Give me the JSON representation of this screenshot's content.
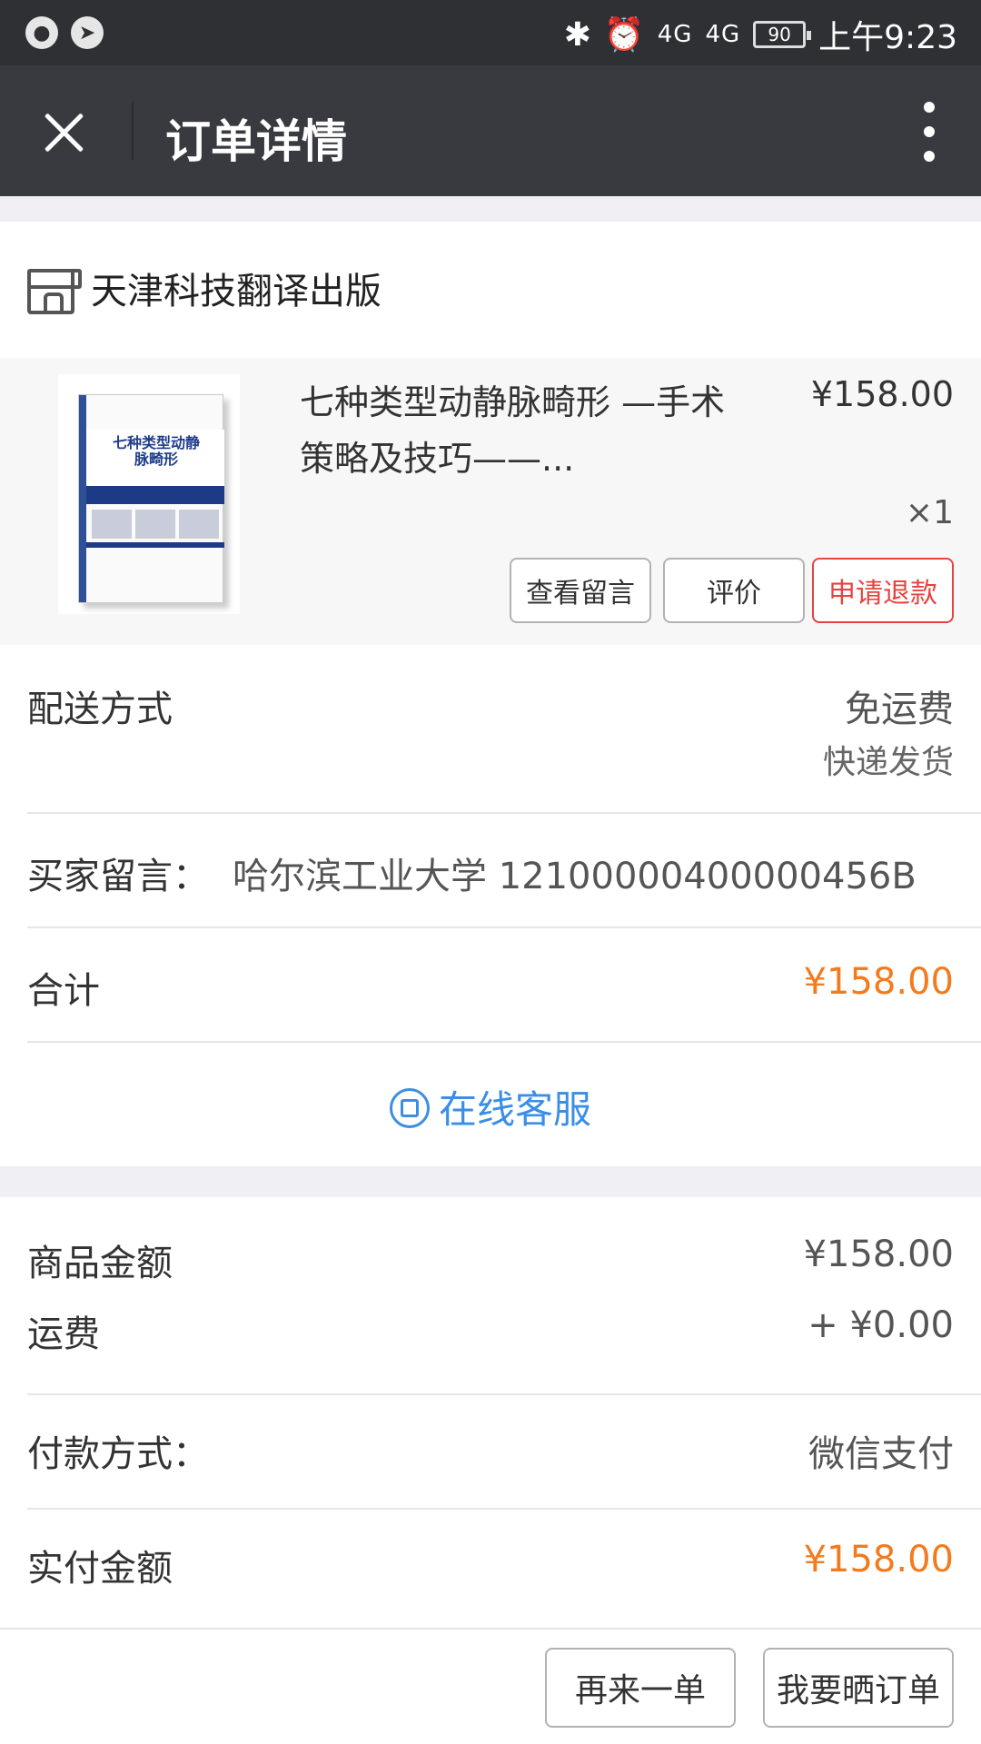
{
  "status_bar": {
    "left_icons": [
      "wechat-icon",
      "location-icon"
    ],
    "battery": "90",
    "network": "4G",
    "time": "上午9:23"
  },
  "title_bar": {
    "title": "订单详情"
  },
  "store": {
    "name": "天津科技翻译出版"
  },
  "product": {
    "name": "七种类型动静脉畸形 —手术策略及技巧——...",
    "price": "¥158.00",
    "quantity": "×1",
    "cover_title": "七种类型动静脉畸形",
    "buttons": {
      "view_message": "查看留言",
      "review": "评价",
      "refund": "申请退款"
    }
  },
  "delivery": {
    "label": "配送方式",
    "fee": "免运费",
    "method": "快递发货"
  },
  "buyer_message": {
    "label": "买家留言：",
    "value": "哈尔滨工业大学 12100000400000456B"
  },
  "total": {
    "label": "合计",
    "value": "¥158.00"
  },
  "customer_service": {
    "label": "在线客服"
  },
  "summary": {
    "goods_amount_label": "商品金额",
    "goods_amount": "¥158.00",
    "shipping_label": "运费",
    "shipping": "+ ¥0.00",
    "payment_method_label": "付款方式：",
    "payment_method": "微信支付",
    "paid_label": "实付金额",
    "paid": "¥158.00"
  },
  "bottom_bar": {
    "reorder": "再来一单",
    "share_order": "我要晒订单"
  }
}
